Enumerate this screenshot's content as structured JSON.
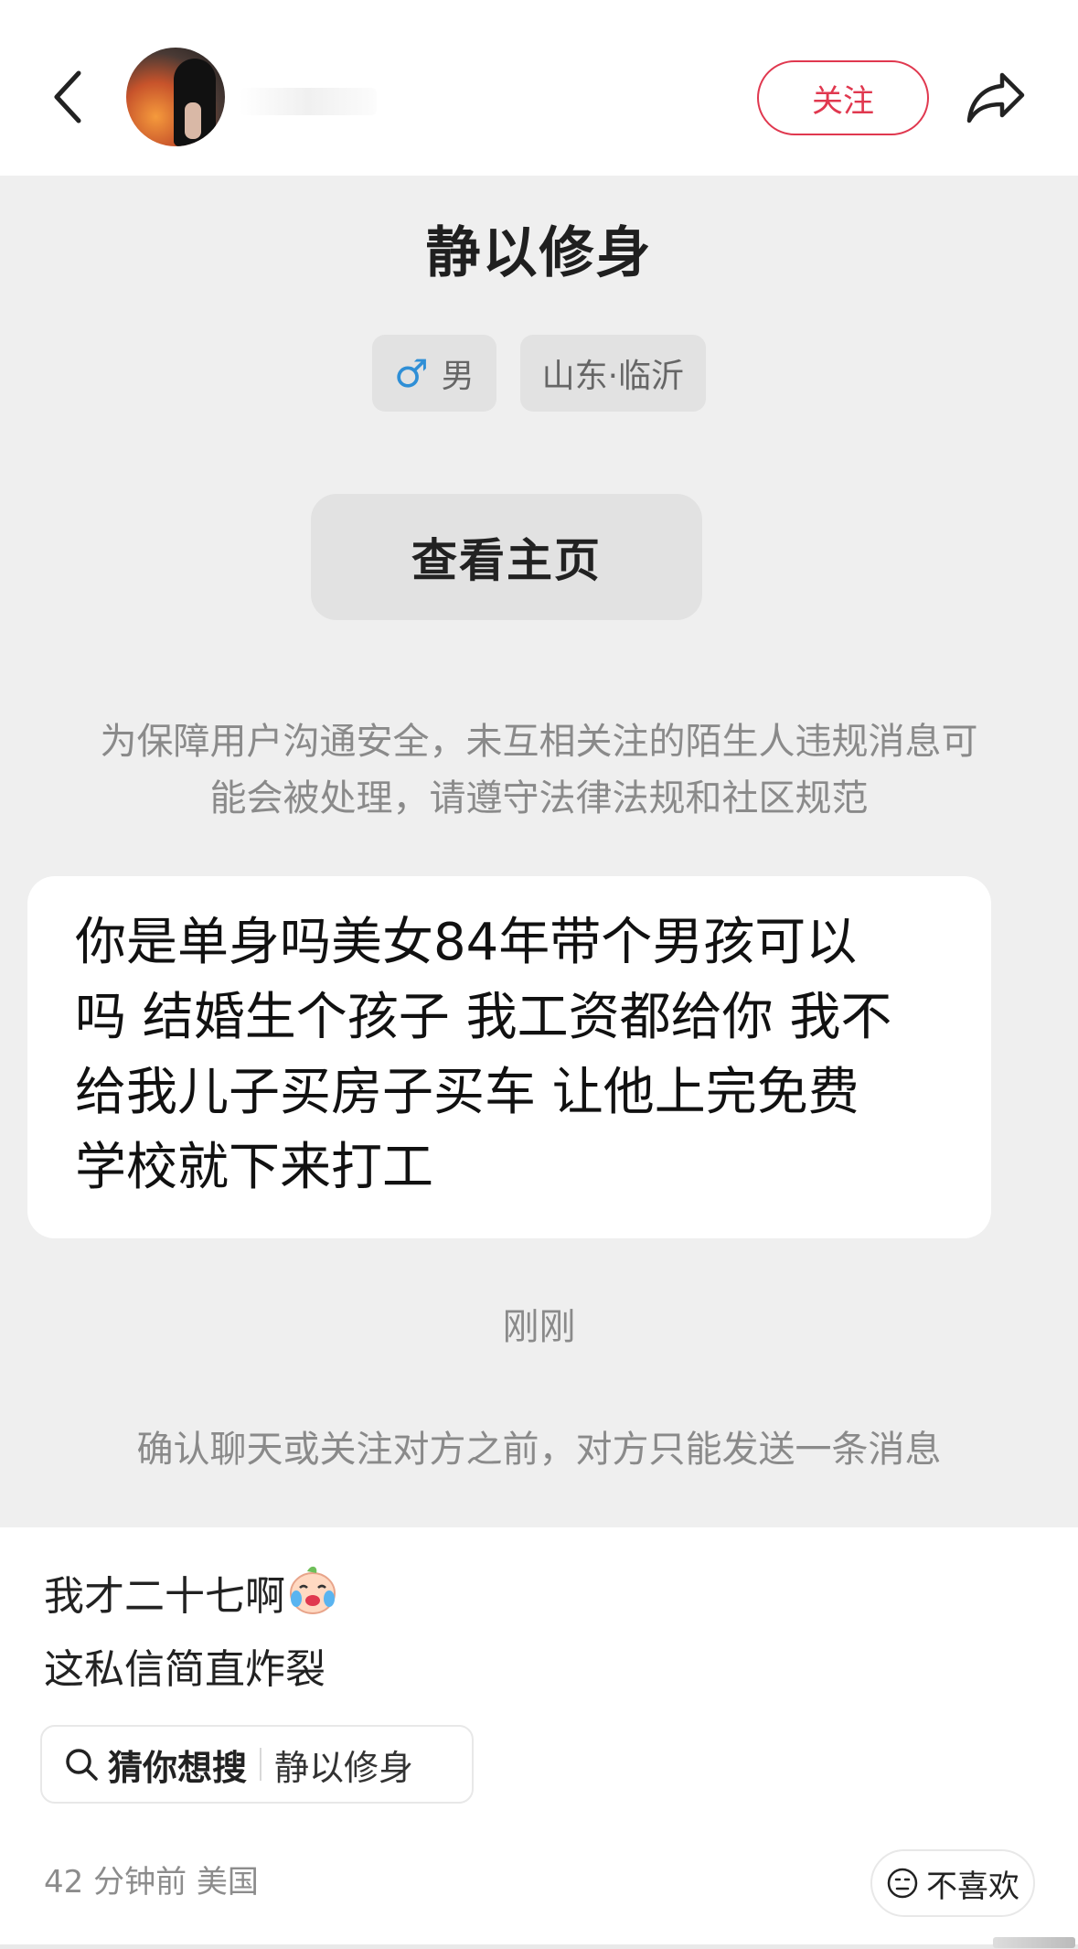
{
  "header": {
    "follow_label": "关注"
  },
  "profile": {
    "name": "静以修身",
    "gender_label": "男",
    "location": "山东·临沂",
    "homepage_button": "查看主页"
  },
  "chat": {
    "safety_notice_line1": "为保障用户沟通安全，未互相关注的陌生人违规消息可",
    "safety_notice_line2": "能会被处理，请遵守法律法规和社区规范",
    "message_line1": "你是单身吗美女84年带个男孩可以",
    "message_line2": "吗 结婚生个孩子 我工资都给你 我不",
    "message_line3": "给我儿子买房子买车 让他上完免费",
    "message_line4": "学校就下来打工",
    "timestamp": "刚刚",
    "limit_note": "确认聊天或关注对方之前，对方只能发送一条消息"
  },
  "post": {
    "caption_line1": "我才二十七啊",
    "caption_line2": "这私信简直炸裂",
    "search_label": "猜你想搜",
    "search_term": "静以修身",
    "meta": "42 分钟前 美国",
    "dislike_label": "不喜欢"
  },
  "colors": {
    "accent": "#e0384f",
    "panel_bg": "#efefef",
    "male_blue": "#2f8fd6"
  },
  "icons": {
    "back": "chevron-left-icon",
    "share": "share-arrow-icon",
    "gender": "male-icon",
    "search": "search-icon",
    "emoji": "crying-emoji-icon",
    "dislike": "frown-face-icon"
  }
}
